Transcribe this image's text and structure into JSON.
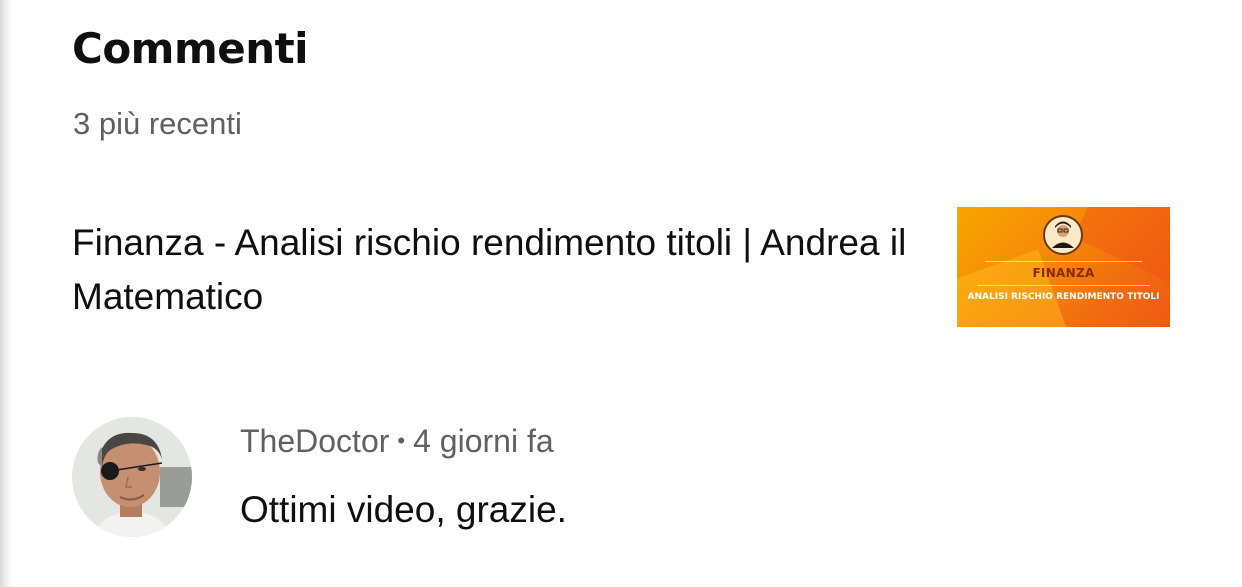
{
  "header": {
    "title": "Commenti",
    "subtitle": "3 più recenti"
  },
  "video": {
    "title": "Finanza - Analisi rischio rendimento titoli | Andrea il Matematico",
    "thumbnail": {
      "title": "FINANZA",
      "subtitle": "ANALISI RISCHIO RENDIMENTO TITOLI",
      "colors": [
        "#f7a600",
        "#f06a10"
      ]
    }
  },
  "comment": {
    "author": "TheDoctor",
    "separator": "•",
    "time": "4 giorni fa",
    "text": "Ottimi video, grazie."
  },
  "colors": {
    "text_primary": "#0f0f0f",
    "text_secondary": "#606060",
    "background": "#ffffff"
  }
}
